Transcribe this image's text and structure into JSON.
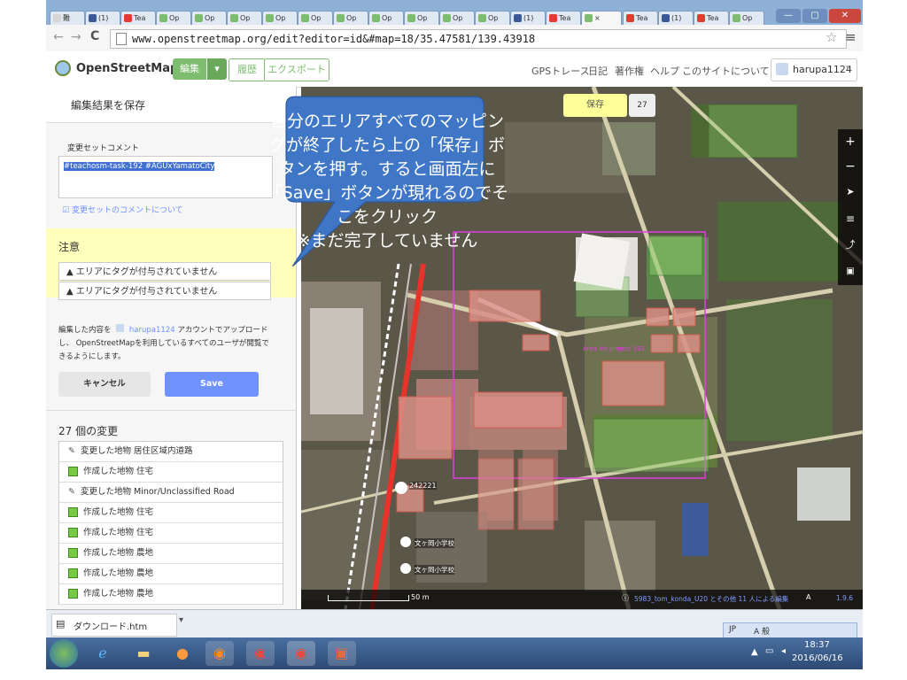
{
  "browser": {
    "tabs": [
      {
        "label": "難"
      },
      {
        "label": "(1)"
      },
      {
        "label": "Tea"
      },
      {
        "label": "Op"
      },
      {
        "label": "Op"
      },
      {
        "label": "Op"
      },
      {
        "label": "Op"
      },
      {
        "label": "Op"
      },
      {
        "label": "Op"
      },
      {
        "label": "Op"
      },
      {
        "label": "Op"
      },
      {
        "label": "Op"
      },
      {
        "label": "Op"
      },
      {
        "label": "(1)"
      },
      {
        "label": "Tea"
      },
      {
        "label": "×"
      },
      {
        "label": "Tea"
      },
      {
        "label": "(1)"
      },
      {
        "label": "Tea"
      },
      {
        "label": "Op"
      }
    ],
    "url": "www.openstreetmap.org/edit?editor=id&#map=18/35.47581/139.43918",
    "back": "←",
    "forward": "→",
    "reload": "C"
  },
  "osm": {
    "logo": "OpenStreetMap",
    "edit_label": "編集",
    "history_label": "履歴",
    "export_label": "エクスポート",
    "nav": [
      "GPSトレース",
      "日記",
      "著作権",
      "ヘルプ",
      "このサイトについて"
    ],
    "user": "harupa1124"
  },
  "sidebar": {
    "title": "編集結果を保存",
    "comment_label": "変更セットコメント",
    "comment_value": "#teachosm-task-192 #AGUxYamatoCity",
    "comment_help": "変更セットのコメントについて",
    "warning_title": "注意",
    "warnings": [
      "エリアにタグが付与されていません",
      "エリアにタグが付与されていません"
    ],
    "upload_text_1": "編集した内容を",
    "upload_user": "harupa1124",
    "upload_text_2": "アカウントでアップロードし、",
    "upload_text_3": "OpenStreetMapを利用しているすべてのユーザが閲覧できるようにします。",
    "cancel_label": "キャンセル",
    "save_label": "Save",
    "changes_title": "27 個の変更",
    "changes": [
      {
        "kind": "edit",
        "text": "変更した地物 居住区域内道路"
      },
      {
        "kind": "new",
        "text": "作成した地物 住宅"
      },
      {
        "kind": "edit",
        "text": "変更した地物 Minor/Unclassified Road"
      },
      {
        "kind": "new",
        "text": "作成した地物 住宅"
      },
      {
        "kind": "new",
        "text": "作成した地物 住宅"
      },
      {
        "kind": "new",
        "text": "作成した地物 農地"
      },
      {
        "kind": "new",
        "text": "作成した地物 農地"
      },
      {
        "kind": "new",
        "text": "作成した地物 農地"
      }
    ]
  },
  "map": {
    "save_label": "保存",
    "change_count": "27",
    "project_label": "Area for project 192",
    "poi_number": "242221",
    "school_1": "文ヶ岡小学校",
    "school_2": "文ヶ岡小学校",
    "scale": "50 m",
    "attribution": "5983_tom_konda_U20 とその他 11 人による編集",
    "zoom_level": "1.9.6",
    "controls": [
      "+",
      "−",
      "➤",
      "≡",
      "⤴",
      "▣"
    ]
  },
  "callout": {
    "lines": [
      "自分のエリアすべてのマッピン",
      "グが終了したら上の「保存」ボ",
      "タンを押す。すると画面左に",
      "「Save」ボタンが現れるのでそ",
      "こをクリック",
      "※まだ完了していません"
    ]
  },
  "download_bar": {
    "file": "ダウンロード.htm"
  },
  "taskbar": {
    "time": "18:37",
    "date": "2016/06/16",
    "ime": "JP",
    "ime_mode": "A 般"
  },
  "colors": {
    "osm_green": "#7ebc6f",
    "save_blue": "#7092ff",
    "callout": "#3f76c6",
    "warning": "#ffffbb"
  }
}
